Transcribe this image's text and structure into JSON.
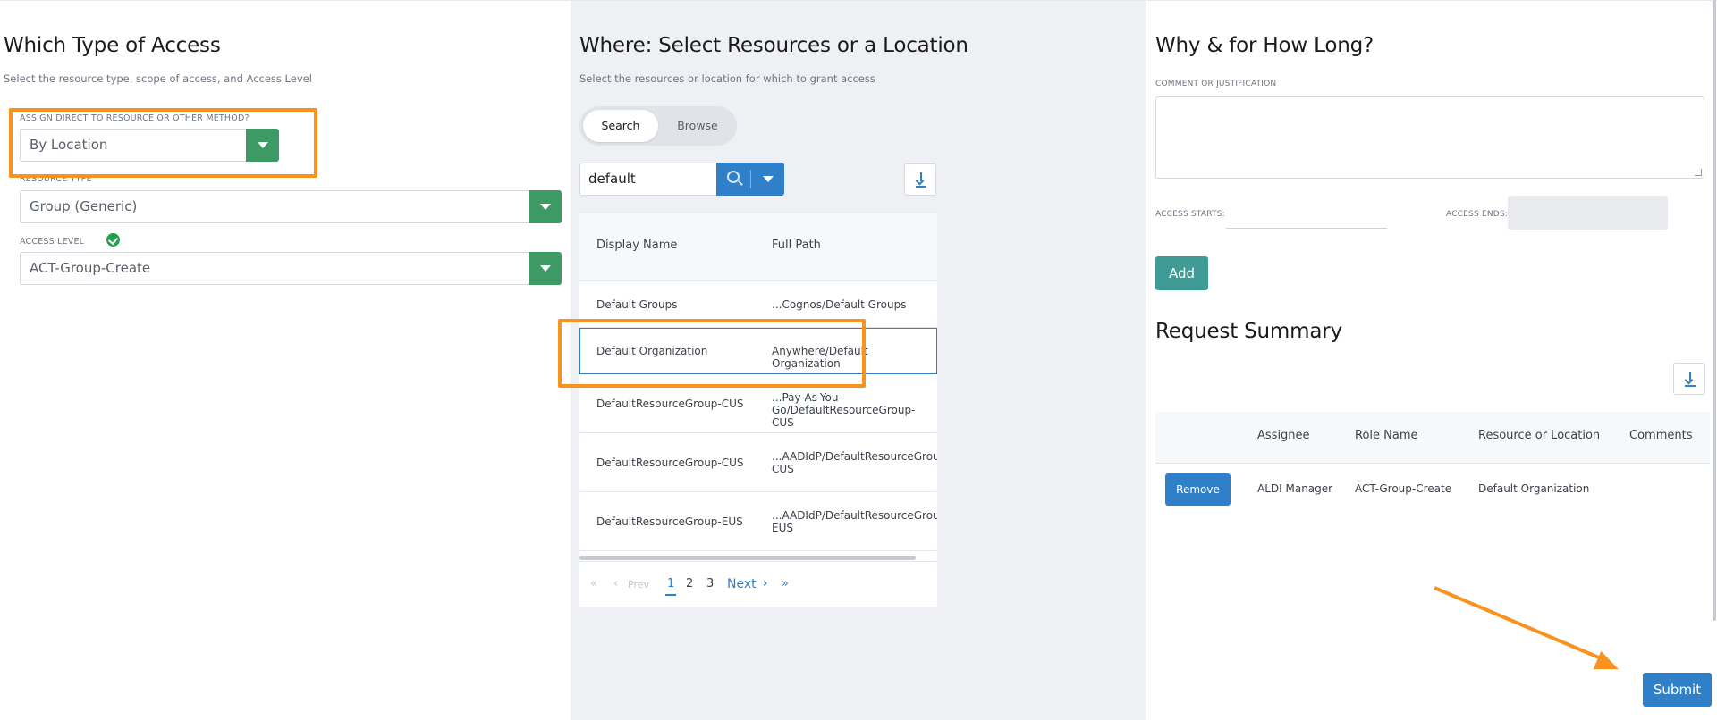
{
  "access_type": {
    "title": "Which Type of Access",
    "subtitle": "Select the resource type, scope of access, and Access Level",
    "assign_label": "ASSIGN DIRECT TO RESOURCE OR OTHER METHOD?",
    "assign_value": "By Location",
    "resource_type_label": "RESOURCE TYPE",
    "resource_type_value": "Group (Generic)",
    "access_level_label": "ACCESS LEVEL",
    "access_level_value": "ACT-Group-Create"
  },
  "where": {
    "title": "Where: Select Resources or a Location",
    "subtitle": "Select the resources or location for which to grant access",
    "tabs": [
      "Search",
      "Browse"
    ],
    "search_value": "default",
    "columns": [
      "Display Name",
      "Full Path"
    ],
    "rows": [
      {
        "name": "Default Groups",
        "path": "...Cognos/Default Groups"
      },
      {
        "name": "Default Organization",
        "path": "Anywhere/Default Organization"
      },
      {
        "name": "DefaultResourceGroup-CUS",
        "path": "...Pay-As-You-Go/DefaultResourceGroup-CUS"
      },
      {
        "name": "DefaultResourceGroup-CUS",
        "path": "...AADIdP/DefaultResourceGroup-CUS"
      },
      {
        "name": "DefaultResourceGroup-EUS",
        "path": "...AADIdP/DefaultResourceGroup-EUS"
      }
    ],
    "pager": {
      "first": "«",
      "prev": "Prev",
      "pages": [
        "1",
        "2",
        "3"
      ],
      "current": "1",
      "next": "Next",
      "last": "»"
    }
  },
  "why": {
    "title": "Why & for How Long?",
    "comment_label": "COMMENT OR JUSTIFICATION",
    "comment_value": "",
    "starts_label": "ACCESS STARTS:",
    "starts_value": "",
    "ends_label": "ACCESS ENDS:",
    "ends_value": "",
    "add_label": "Add"
  },
  "summary": {
    "title": "Request Summary",
    "columns": [
      "Assignee",
      "Role Name",
      "Resource or Location",
      "Comments"
    ],
    "rows": [
      {
        "action": "Remove",
        "assignee": "ALDI Manager",
        "role": "ACT-Group-Create",
        "resource": "Default Organization",
        "comments": ""
      }
    ],
    "submit_label": "Submit"
  },
  "colors": {
    "accent_green": "#3e9a64",
    "accent_blue": "#2f80c8",
    "teal": "#3f9b95",
    "highlight_orange": "#f7931e"
  },
  "icons": [
    "chevron-down-icon",
    "search-icon",
    "download-icon",
    "check-circle-icon",
    "double-chevron-left-icon",
    "chevron-left-icon",
    "chevron-right-icon",
    "double-chevron-right-icon"
  ]
}
